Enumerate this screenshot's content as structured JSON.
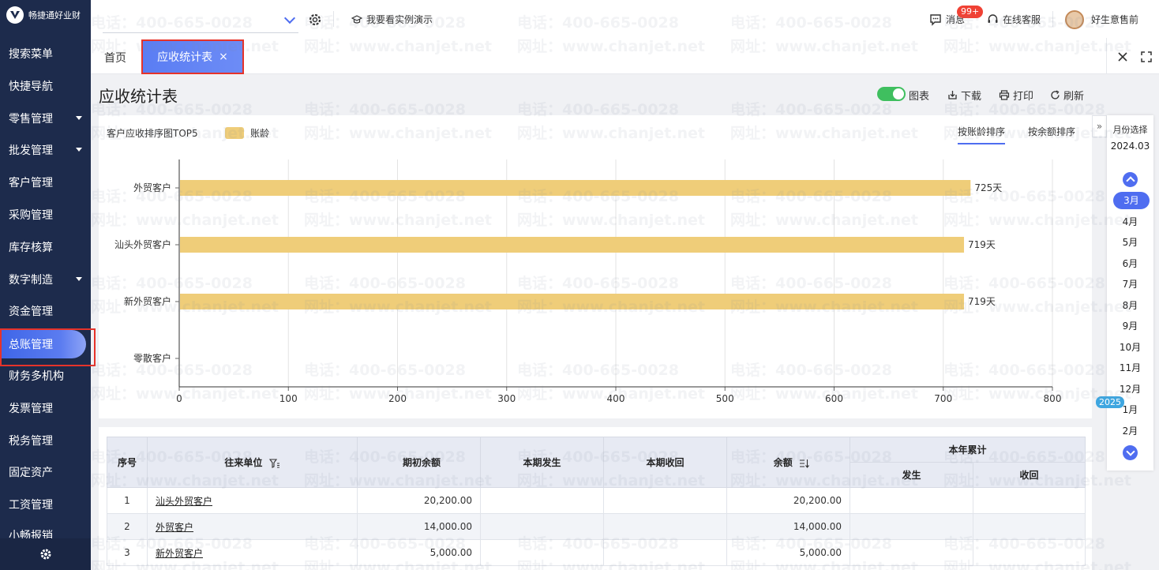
{
  "app": {
    "logo_text": "畅捷通好业财"
  },
  "sidebar": {
    "items": [
      {
        "label": "搜索菜单",
        "caret": false
      },
      {
        "label": "快捷导航",
        "caret": false
      },
      {
        "label": "零售管理",
        "caret": true
      },
      {
        "label": "批发管理",
        "caret": true
      },
      {
        "label": "客户管理",
        "caret": false
      },
      {
        "label": "采购管理",
        "caret": false
      },
      {
        "label": "库存核算",
        "caret": false
      },
      {
        "label": "数字制造",
        "caret": true
      },
      {
        "label": "资金管理",
        "caret": false
      },
      {
        "label": "总账管理",
        "caret": false,
        "active": true
      },
      {
        "label": "财务多机构",
        "caret": false
      },
      {
        "label": "发票管理",
        "caret": false
      },
      {
        "label": "税务管理",
        "caret": false
      },
      {
        "label": "固定资产",
        "caret": false
      },
      {
        "label": "工资管理",
        "caret": false
      },
      {
        "label": "小畅报销",
        "caret": false
      }
    ]
  },
  "topbar": {
    "demo_label": "我要看实例演示",
    "messages_label": "消息",
    "messages_badge": "99+",
    "service_label": "在线客服",
    "user_name": "好生意售前"
  },
  "tabs": {
    "home": "首页",
    "active": "应收统计表"
  },
  "page": {
    "title": "应收统计表",
    "toggle_label": "图表",
    "download_label": "下载",
    "print_label": "打印",
    "refresh_label": "刷新"
  },
  "chart_data": {
    "type": "bar",
    "orientation": "horizontal",
    "title": "客户应收排序图TOP5",
    "categories": [
      "外贸客户",
      "汕头外贸客户",
      "新外贸客户",
      "零散客户"
    ],
    "series": [
      {
        "name": "账龄",
        "values": [
          725,
          719,
          719,
          0
        ],
        "labels": [
          "725天",
          "719天",
          "719天",
          ""
        ],
        "color": "#efcd79"
      }
    ],
    "xlim": [
      0,
      800
    ],
    "xticks": [
      0,
      100,
      200,
      300,
      400,
      500,
      600,
      700,
      800
    ],
    "grid": true,
    "legend": "top-left",
    "sort_tabs": [
      "按账龄排序",
      "按余额排序"
    ],
    "active_sort": 0
  },
  "month_picker": {
    "label": "月份选择",
    "value": "2024.03",
    "months": [
      "3月",
      "4月",
      "5月",
      "6月",
      "7月",
      "8月",
      "9月",
      "10月",
      "11月",
      "12月",
      "1月",
      "2月"
    ],
    "selected": 0,
    "year_tag": "2025"
  },
  "table": {
    "headers": {
      "index": "序号",
      "partner": "往来单位",
      "opening": "期初余额",
      "current_occur": "本期发生",
      "current_collect": "本期收回",
      "balance": "余额",
      "ytd": "本年累计",
      "ytd_occur": "发生",
      "ytd_collect": "收回"
    },
    "rows": [
      {
        "index": "1",
        "partner": "汕头外贸客户",
        "opening": "20,200.00",
        "current_occur": "",
        "current_collect": "",
        "balance": "20,200.00",
        "ytd_occur": "",
        "ytd_collect": ""
      },
      {
        "index": "2",
        "partner": "外贸客户",
        "opening": "14,000.00",
        "current_occur": "",
        "current_collect": "",
        "balance": "14,000.00",
        "ytd_occur": "",
        "ytd_collect": ""
      },
      {
        "index": "3",
        "partner": "新外贸客户",
        "opening": "5,000.00",
        "current_occur": "",
        "current_collect": "",
        "balance": "5,000.00",
        "ytd_occur": "",
        "ytd_collect": ""
      }
    ]
  },
  "watermark": {
    "line1": "电话：400-665-0028",
    "line2": "网址：www.chanjet.net"
  }
}
